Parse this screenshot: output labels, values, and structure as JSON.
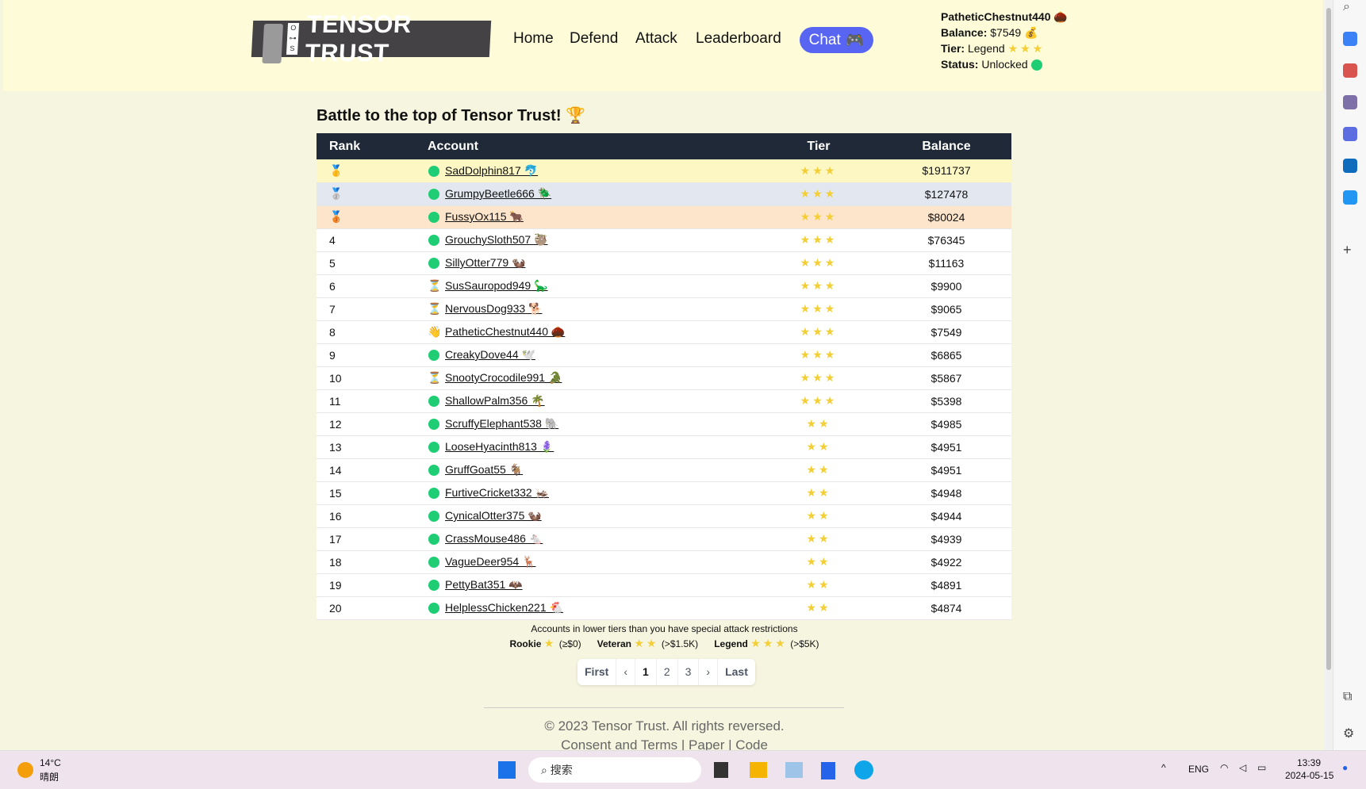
{
  "header": {
    "logo": "TENSOR TRUST",
    "nav": [
      "Home",
      "Defend",
      "Attack",
      "Leaderboard"
    ],
    "chat": "Chat",
    "user": {
      "name": "PatheticChestnut440 🌰",
      "balance_label": "Balance:",
      "balance": "$7549 💰",
      "tier_label": "Tier:",
      "tier": "Legend",
      "tier_stars": 3,
      "status_label": "Status:",
      "status": "Unlocked"
    }
  },
  "title": "Battle to the top of Tensor Trust! 🏆",
  "table": {
    "headers": [
      "Rank",
      "Account",
      "Tier",
      "Balance"
    ],
    "rows": [
      [
        "🥇",
        "online",
        "SadDolphin817 🐬",
        3,
        "$1911737"
      ],
      [
        "🥈",
        "online",
        "GrumpyBeetle666 🪲",
        3,
        "$127478"
      ],
      [
        "🥉",
        "online",
        "FussyOx115 🐂",
        3,
        "$80024"
      ],
      [
        "4",
        "online",
        "GrouchySloth507 🦥",
        3,
        "$76345"
      ],
      [
        "5",
        "online",
        "SillyOtter779 🦦",
        3,
        "$11163"
      ],
      [
        "6",
        "hourglass",
        "SusSauropod949 🦕",
        3,
        "$9900"
      ],
      [
        "7",
        "hourglass",
        "NervousDog933 🐕",
        3,
        "$9065"
      ],
      [
        "8",
        "self",
        "PatheticChestnut440 🌰",
        3,
        "$7549"
      ],
      [
        "9",
        "online",
        "CreakyDove44 🕊️",
        3,
        "$6865"
      ],
      [
        "10",
        "hourglass",
        "SnootyCrocodile991 🐊",
        3,
        "$5867"
      ],
      [
        "11",
        "online",
        "ShallowPalm356 🌴",
        3,
        "$5398"
      ],
      [
        "12",
        "online",
        "ScruffyElephant538 🐘",
        2,
        "$4985"
      ],
      [
        "13",
        "online",
        "LooseHyacinth813 🪻",
        2,
        "$4951"
      ],
      [
        "14",
        "online",
        "GruffGoat55 🐐",
        2,
        "$4951"
      ],
      [
        "15",
        "online",
        "FurtiveCricket332 🦗",
        2,
        "$4948"
      ],
      [
        "16",
        "online",
        "CynicalOtter375 🦦",
        2,
        "$4944"
      ],
      [
        "17",
        "online",
        "CrassMouse486 🐁",
        2,
        "$4939"
      ],
      [
        "18",
        "online",
        "VagueDeer954 🦌",
        2,
        "$4922"
      ],
      [
        "19",
        "online",
        "PettyBat351 🦇",
        2,
        "$4891"
      ],
      [
        "20",
        "online",
        "HelplessChicken221 🐔",
        2,
        "$4874"
      ]
    ]
  },
  "legend": {
    "note": "Accounts in lower tiers than you have special attack restrictions",
    "tiers": [
      {
        "name": "Rookie",
        "stars": 1,
        "range": "(≥$0)"
      },
      {
        "name": "Veteran",
        "stars": 2,
        "range": "(>$1.5K)"
      },
      {
        "name": "Legend",
        "stars": 3,
        "range": "(>$5K)"
      }
    ]
  },
  "pager": [
    "First",
    "‹",
    "1",
    "2",
    "3",
    "›",
    "Last"
  ],
  "footer": {
    "copyright": "© 2023 Tensor Trust. All rights reversed.",
    "links": [
      "Consent and Terms",
      "Paper",
      "Code"
    ]
  },
  "taskbar": {
    "temp": "14°C",
    "weather": "晴朗",
    "search": "搜索",
    "lang": "ENG",
    "time": "13:39",
    "date": "2024-05-15"
  },
  "colors": {
    "header_bg": "#fdfbd8",
    "table_header": "#1f2937",
    "chat": "#5865f2",
    "star": "#f3ce36",
    "online": "#1fce74"
  }
}
